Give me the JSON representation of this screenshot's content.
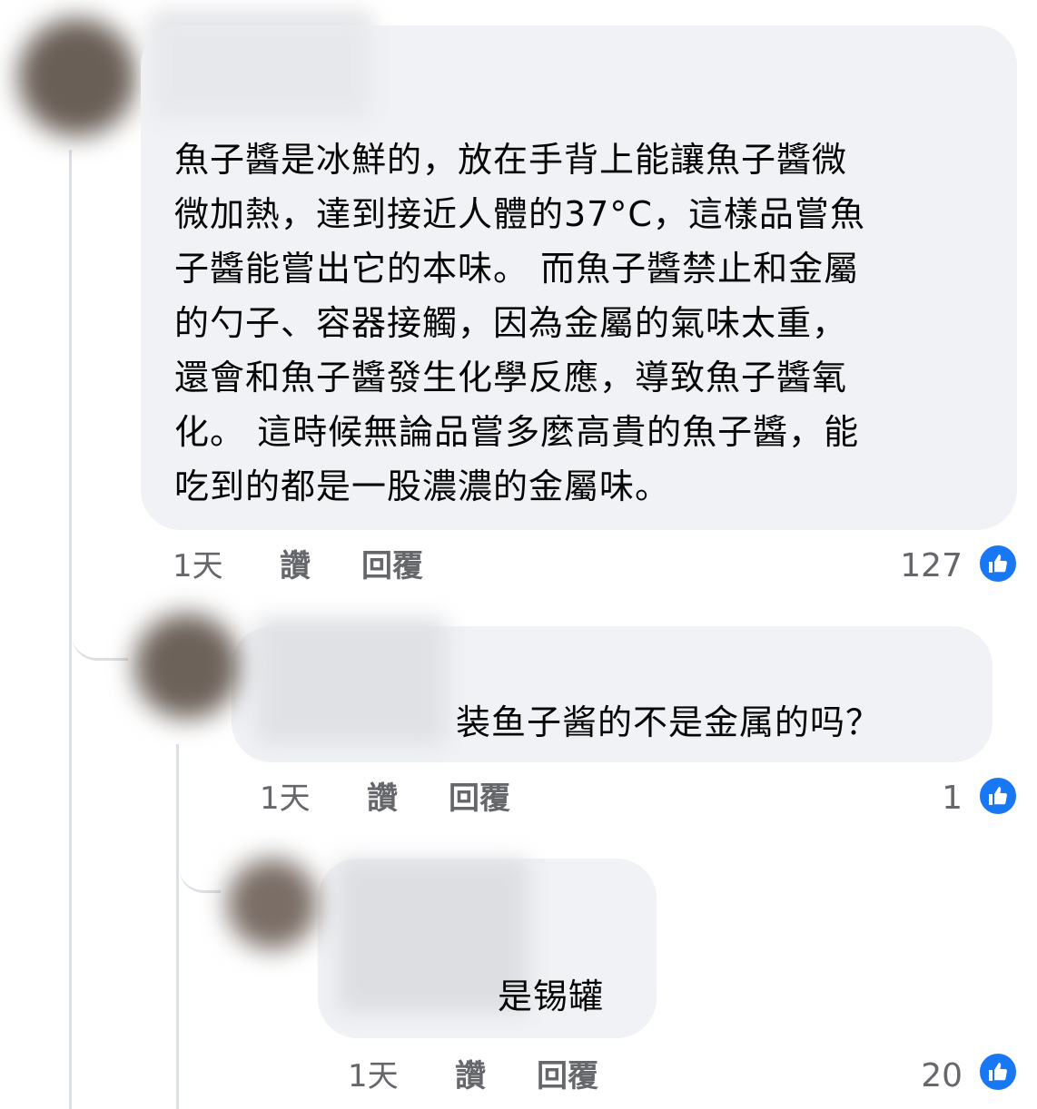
{
  "comments": [
    {
      "text": "魚子醬是冰鮮的，放在手背上能讓魚子醬微微加熱，達到接近人體的37°C，這樣品嘗魚子醬能嘗出它的本味。 而魚子醬禁止和金屬的勺子、容器接觸，因為金屬的氣味太重，還會和魚子醬發生化學反應，導致魚子醬氧化。 這時候無論品嘗多麼高貴的魚子醬，能吃到的都是一股濃濃的金屬味。",
      "lines": [
        "魚子醬是冰鮮的，放在手背上能讓魚子醬微",
        "微加熱，達到接近人體的37°C，這樣品嘗魚",
        "子醬能嘗出它的本味。 而魚子醬禁止和金屬",
        "的勺子、容器接觸，因為金屬的氣味太重，",
        "還會和魚子醬發生化學反應，導致魚子醬氧",
        "化。 這時候無論品嘗多麼高貴的魚子醬，能",
        "吃到的都是一股濃濃的金屬味。"
      ],
      "time": "1天",
      "like_label": "讚",
      "reply_label": "回覆",
      "reaction_count": "127",
      "reaction_icon": "thumbs-up-icon"
    },
    {
      "text": "装鱼子酱的不是金属的吗？",
      "time": "1天",
      "like_label": "讚",
      "reply_label": "回覆",
      "reaction_count": "1",
      "reaction_icon": "thumbs-up-icon"
    },
    {
      "text": "是锡罐",
      "time": "1天",
      "like_label": "讚",
      "reply_label": "回覆",
      "reaction_count": "20",
      "reaction_icon": "thumbs-up-icon"
    }
  ],
  "colors": {
    "bubble": "#f0f2f5",
    "meta_text": "#65676b",
    "like_blue": "#1877f2",
    "thread_line": "#dcdfe4"
  }
}
